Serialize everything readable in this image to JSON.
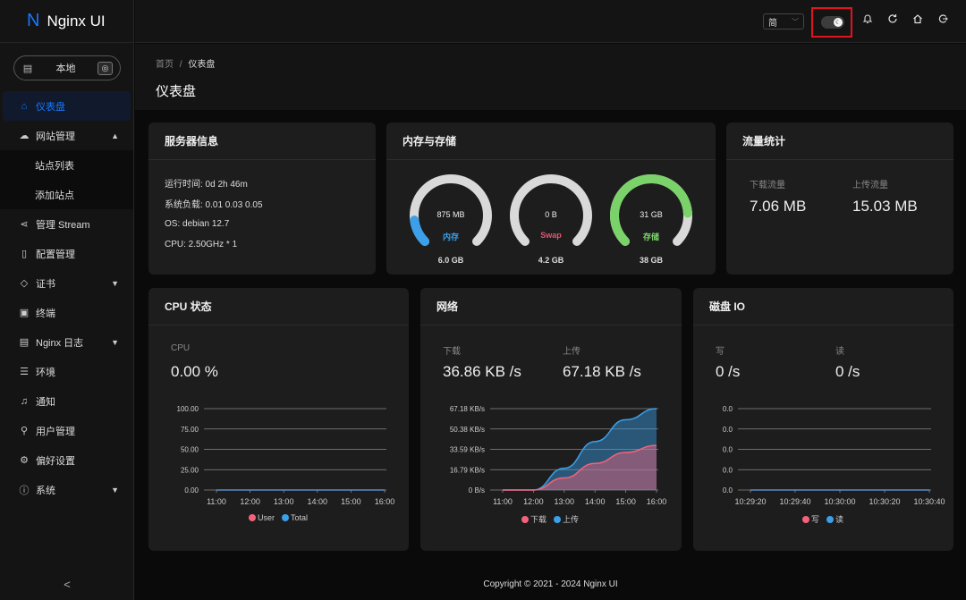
{
  "app": {
    "logo_letter": "N",
    "title": "Nginx UI"
  },
  "env": {
    "label": "本地"
  },
  "sidebar": {
    "items": [
      {
        "label": "仪表盘",
        "icon": "home-icon"
      },
      {
        "label": "网站管理",
        "icon": "cloud-icon"
      },
      {
        "label": "站点列表"
      },
      {
        "label": "添加站点"
      },
      {
        "label": "管理 Stream",
        "icon": "share-icon"
      },
      {
        "label": "配置管理",
        "icon": "file-icon"
      },
      {
        "label": "证书",
        "icon": "shield-icon"
      },
      {
        "label": "终端",
        "icon": "terminal-icon"
      },
      {
        "label": "Nginx 日志",
        "icon": "file-text-icon"
      },
      {
        "label": "环境",
        "icon": "database-icon"
      },
      {
        "label": "通知",
        "icon": "bell-icon"
      },
      {
        "label": "用户管理",
        "icon": "user-icon"
      },
      {
        "label": "偏好设置",
        "icon": "gear-icon"
      },
      {
        "label": "系统",
        "icon": "info-icon"
      }
    ],
    "collapse": "<"
  },
  "header": {
    "lang": "简"
  },
  "breadcrumb": {
    "home": "首页",
    "sep": "/",
    "current": "仪表盘"
  },
  "page_title": "仪表盘",
  "server": {
    "title": "服务器信息",
    "uptime": "运行时间: 0d 2h 46m",
    "load": "系统负载: 0.01 0.03 0.05",
    "os": "OS: debian 12.7",
    "cpu": "CPU: 2.50GHz * 1"
  },
  "memory": {
    "title": "内存与存储",
    "gauges": [
      {
        "value": "875 MB",
        "label": "内存",
        "total": "6.0 GB",
        "percent": 14,
        "color": "#3ba0e9"
      },
      {
        "value": "0 B",
        "label": "Swap",
        "total": "4.2 GB",
        "percent": 0,
        "color": "#e6566f"
      },
      {
        "value": "31 GB",
        "label": "存储",
        "total": "38 GB",
        "percent": 82,
        "color": "#7bd26a"
      }
    ]
  },
  "traffic": {
    "title": "流量统计",
    "down_label": "下载流量",
    "down_value": "7.06 MB",
    "up_label": "上传流量",
    "up_value": "15.03 MB"
  },
  "cpu_card": {
    "title": "CPU 状态",
    "label": "CPU",
    "value": "0.00 %",
    "legend": [
      "User",
      "Total"
    ]
  },
  "network_card": {
    "title": "网络",
    "down_label": "下载",
    "down_value": "36.86 KB /s",
    "up_label": "上传",
    "up_value": "67.18 KB /s",
    "legend": [
      "下载",
      "上传"
    ]
  },
  "disk_card": {
    "title": "磁盘 IO",
    "write_label": "写",
    "write_value": "0 /s",
    "read_label": "读",
    "read_value": "0 /s",
    "legend": [
      "写",
      "读"
    ]
  },
  "chart_data": [
    {
      "type": "line",
      "title": "CPU",
      "x": [
        "11:00",
        "12:00",
        "13:00",
        "14:00",
        "15:00",
        "16:00"
      ],
      "ytick_labels": [
        "0.00",
        "25.00",
        "50.00",
        "75.00",
        "100.00"
      ],
      "ylim": [
        0,
        100
      ],
      "series": [
        {
          "name": "User",
          "color": "#f2637b",
          "values": [
            0,
            0,
            0,
            0,
            0,
            0
          ]
        },
        {
          "name": "Total",
          "color": "#3ba0e9",
          "values": [
            0,
            0,
            0,
            0,
            0,
            0
          ]
        }
      ]
    },
    {
      "type": "area",
      "title": "网络",
      "x": [
        "11:00",
        "12:00",
        "13:00",
        "14:00",
        "15:00",
        "16:00"
      ],
      "ytick_labels": [
        "0 B/s",
        "16.79 KB/s",
        "33.59 KB/s",
        "50.38 KB/s",
        "67.18 KB/s"
      ],
      "ylim": [
        0,
        67.18
      ],
      "series": [
        {
          "name": "下载",
          "color": "#f2637b",
          "values": [
            0,
            0,
            10,
            22,
            31,
            36.86
          ]
        },
        {
          "name": "上传",
          "color": "#3ba0e9",
          "values": [
            0,
            0,
            18,
            40,
            58,
            67.18
          ]
        }
      ]
    },
    {
      "type": "line",
      "title": "磁盘 IO",
      "x": [
        "10:29:20",
        "10:29:40",
        "10:30:00",
        "10:30:20",
        "10:30:40"
      ],
      "ytick_labels": [
        "0.0",
        "0.0",
        "0.0",
        "0.0",
        "0.0"
      ],
      "ylim": [
        0,
        1
      ],
      "series": [
        {
          "name": "写",
          "color": "#f2637b",
          "values": [
            0,
            0,
            0,
            0,
            0
          ]
        },
        {
          "name": "读",
          "color": "#3ba0e9",
          "values": [
            0,
            0,
            0,
            0,
            0
          ]
        }
      ]
    }
  ],
  "footer": "Copyright © 2021 - 2024 Nginx UI"
}
